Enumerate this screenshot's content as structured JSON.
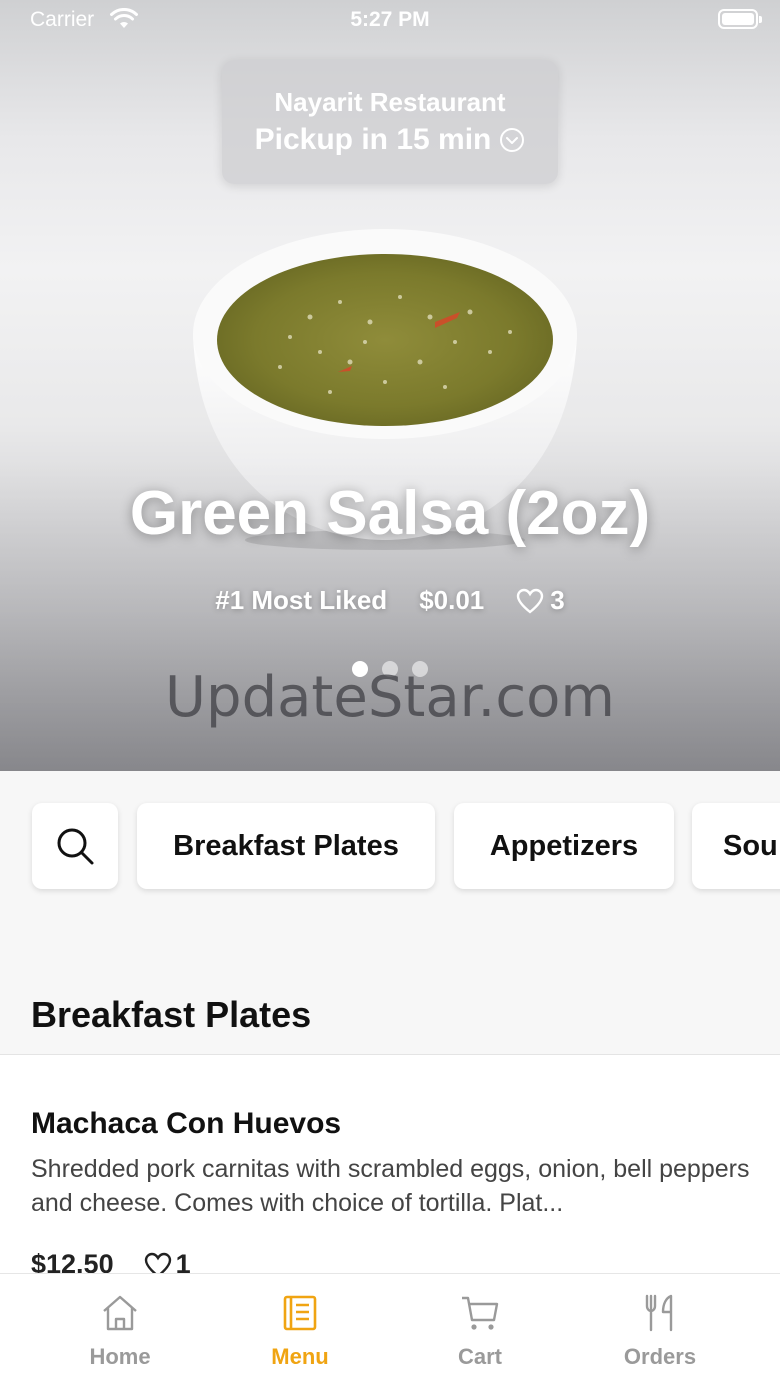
{
  "status_bar": {
    "carrier": "Carrier",
    "time": "5:27 PM"
  },
  "pickup": {
    "restaurant": "Nayarit Restaurant",
    "label": "Pickup in 15 min"
  },
  "hero": {
    "title": "Green Salsa (2oz)",
    "rank": "#1 Most Liked",
    "price": "$0.01",
    "likes": "3",
    "carousel_pages": 3,
    "active_page": 1,
    "watermark": "UpdateStar.com"
  },
  "categories": {
    "search_icon": "search-icon",
    "items": [
      "Breakfast Plates",
      "Appetizers",
      "Sou"
    ]
  },
  "section": {
    "title": "Breakfast Plates"
  },
  "menu_item": {
    "name": "Machaca Con Huevos",
    "description": "Shredded pork carnitas with scrambled eggs, onion, bell peppers and cheese. Comes with choice of tortilla. Plat...",
    "price": "$12.50",
    "likes": "1"
  },
  "tabs": [
    {
      "label": "Home",
      "icon": "home-icon",
      "active": false
    },
    {
      "label": "Menu",
      "icon": "menu-icon",
      "active": true
    },
    {
      "label": "Cart",
      "icon": "cart-icon",
      "active": false
    },
    {
      "label": "Orders",
      "icon": "utensils-icon",
      "active": false
    }
  ],
  "colors": {
    "accent": "#f0a412",
    "inactive_tab": "#9a9a9a"
  }
}
